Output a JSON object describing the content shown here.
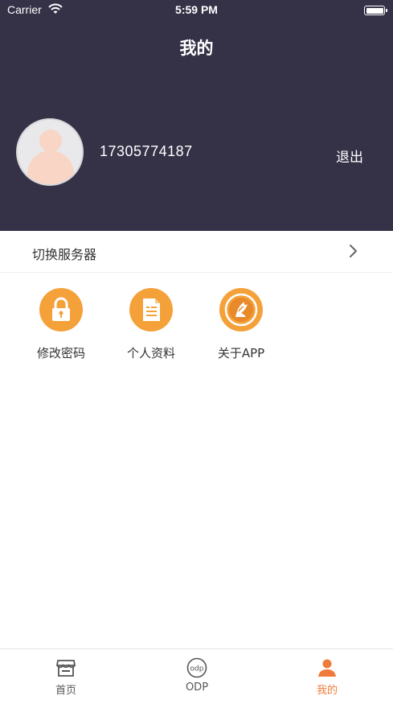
{
  "status_bar": {
    "carrier": "Carrier",
    "time": "5:59 PM"
  },
  "header": {
    "title": "我的"
  },
  "profile": {
    "phone": "17305774187",
    "logout_label": "退出"
  },
  "server_row": {
    "label": "切换服务器"
  },
  "grid": [
    {
      "label": "修改密码",
      "icon": "lock-icon"
    },
    {
      "label": "个人资料",
      "icon": "document-icon"
    },
    {
      "label": "关于APP",
      "icon": "app-logo-icon"
    }
  ],
  "tabbar": [
    {
      "label": "首页",
      "icon": "shop-icon",
      "active": false
    },
    {
      "label": "ODP",
      "icon": "odp-logo-icon",
      "active": false
    },
    {
      "label": "我的",
      "icon": "person-icon",
      "active": true
    }
  ],
  "colors": {
    "header_bg": "#353147",
    "accent": "#f5a13a",
    "active_tab": "#f07a3a"
  }
}
